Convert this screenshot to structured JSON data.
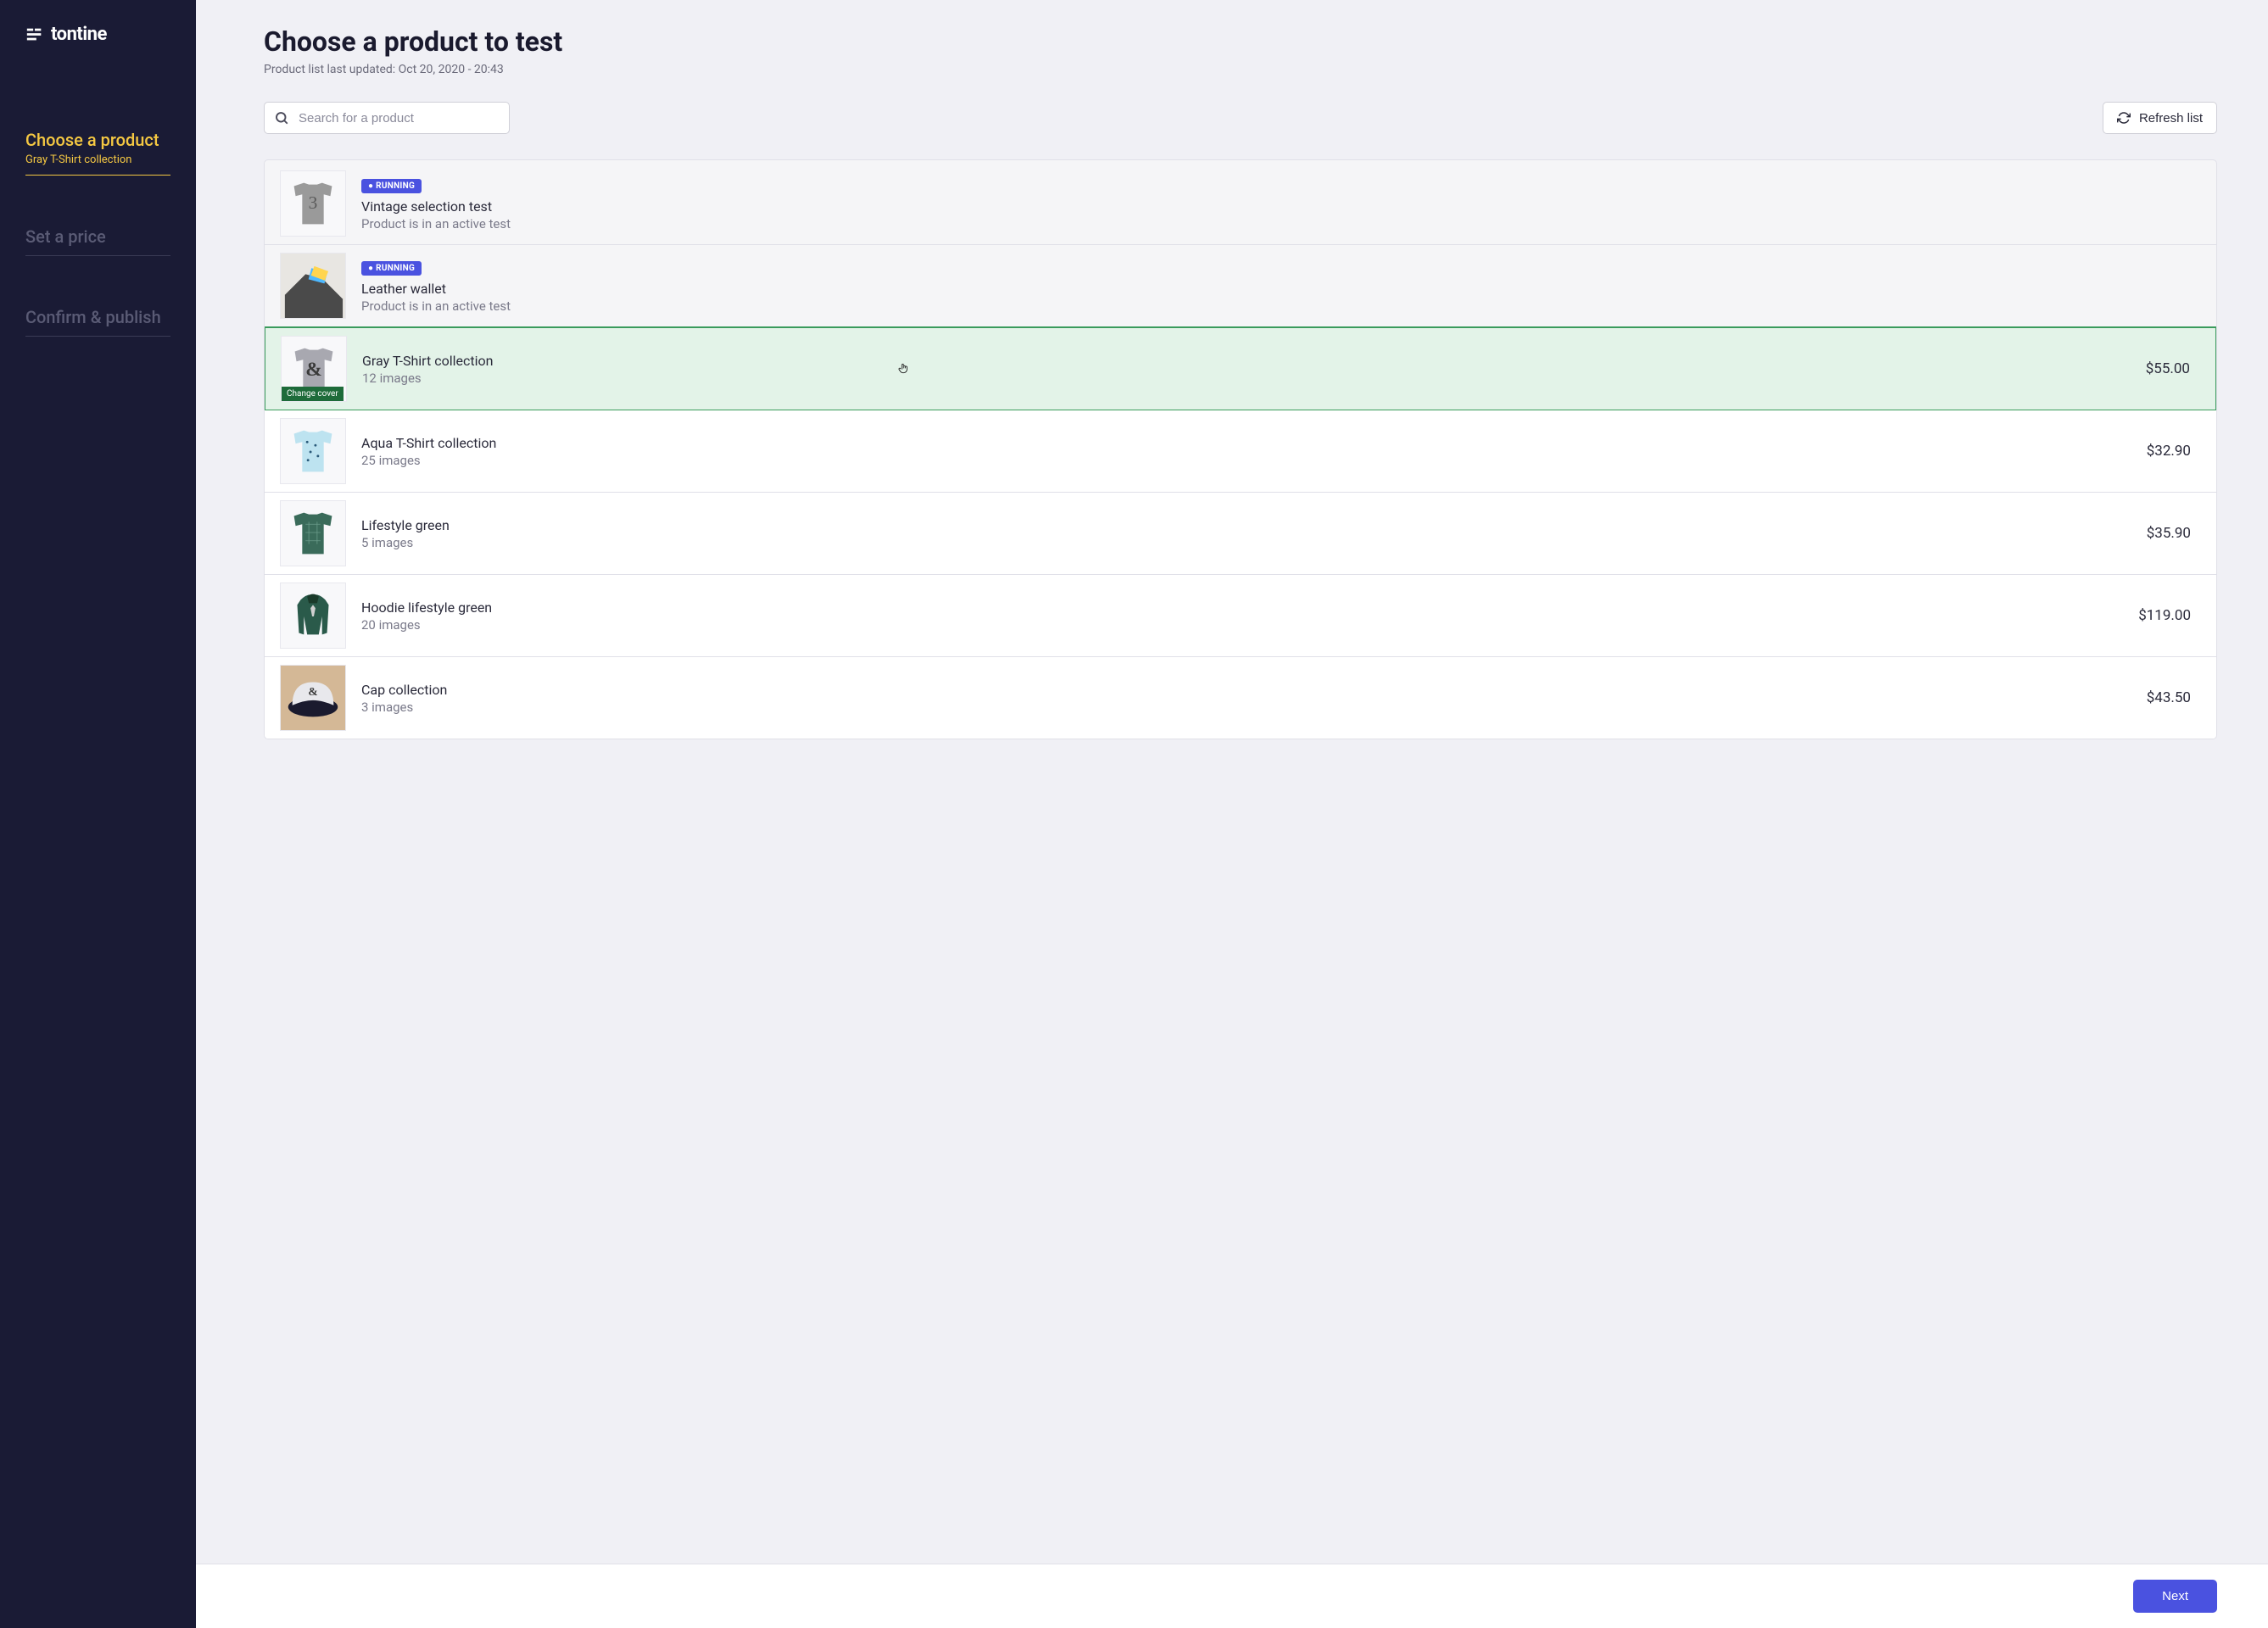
{
  "brand": "tontine",
  "sidebar": {
    "steps": [
      {
        "title": "Choose a product",
        "subtitle": "Gray T-Shirt collection",
        "active": true
      },
      {
        "title": "Set a price",
        "subtitle": "",
        "active": false
      },
      {
        "title": "Confirm & publish",
        "subtitle": "",
        "active": false
      }
    ]
  },
  "page": {
    "title": "Choose a product to test",
    "subtitle": "Product list last updated: Oct 20, 2020 - 20:43"
  },
  "search": {
    "placeholder": "Search for a product"
  },
  "refresh_label": "Refresh list",
  "change_cover_label": "Change cover",
  "status_running": "● RUNNING",
  "products": [
    {
      "name": "Vintage selection test",
      "meta": "Product is in an active test",
      "price": "",
      "running": true
    },
    {
      "name": "Leather wallet",
      "meta": "Product is in an active test",
      "price": "",
      "running": true
    },
    {
      "name": "Gray T-Shirt collection",
      "meta": "12 images",
      "price": "$55.00",
      "running": false,
      "selected": true
    },
    {
      "name": "Aqua T-Shirt collection",
      "meta": "25 images",
      "price": "$32.90",
      "running": false
    },
    {
      "name": "Lifestyle green",
      "meta": "5 images",
      "price": "$35.90",
      "running": false
    },
    {
      "name": "Hoodie lifestyle green",
      "meta": "20 images",
      "price": "$119.00",
      "running": false
    },
    {
      "name": "Cap collection",
      "meta": "3 images",
      "price": "$43.50",
      "running": false
    }
  ],
  "footer": {
    "next_label": "Next"
  }
}
